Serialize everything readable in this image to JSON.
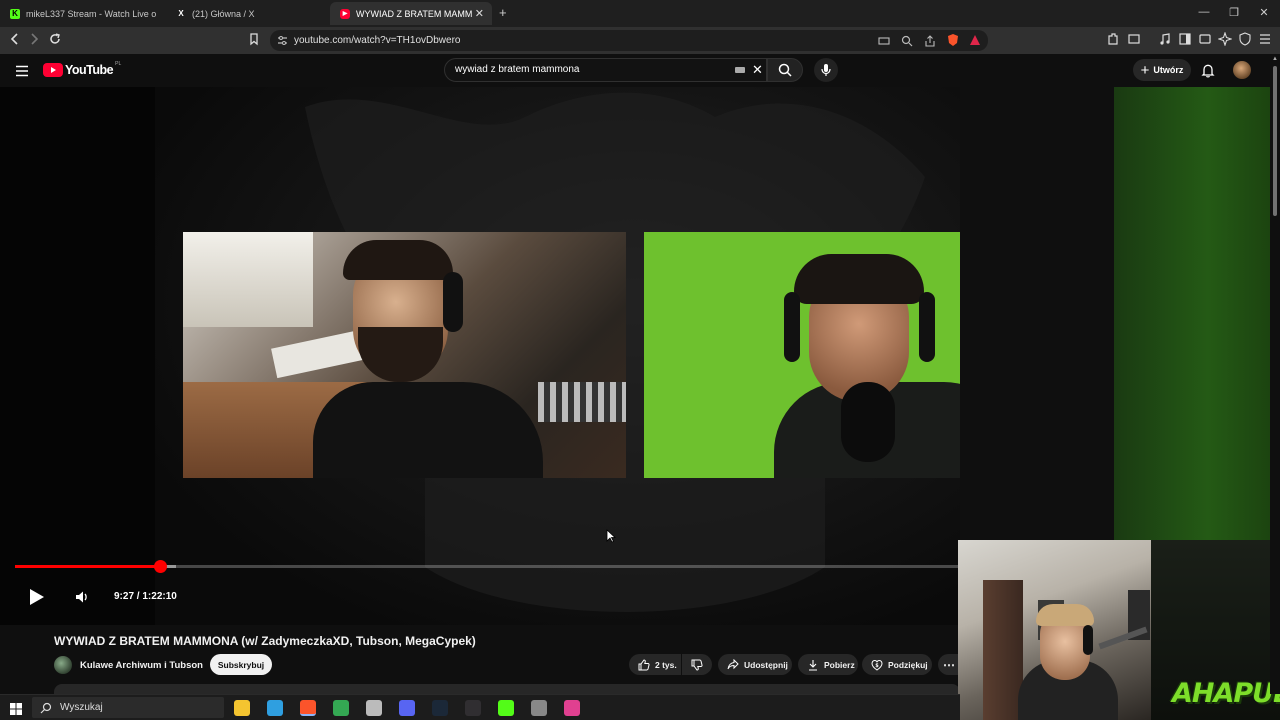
{
  "browser": {
    "tabs": [
      {
        "title": "mikeL337 Stream - Watch Live o",
        "favicon_color": "#53fc18",
        "favicon_glyph": "K",
        "active": false
      },
      {
        "title": "(21) Główna / X",
        "favicon_color": "#000000",
        "favicon_glyph": "X",
        "active": false
      },
      {
        "title": "WYWIAD Z BRATEM MAMMON/",
        "favicon_color": "#ff0033",
        "favicon_glyph": "▶",
        "active": true
      }
    ],
    "url": "youtube.com/watch?v=TH1ovDbwero"
  },
  "youtube": {
    "logo_text": "YouTube",
    "region": "PL",
    "search_value": "wywiad z bratem mammona",
    "create_label": "Utwórz"
  },
  "player": {
    "progress_fraction": 0.1537,
    "buffered_fraction": 0.17,
    "time_current": "9:27",
    "time_separator": "/",
    "time_total": "1:22:10"
  },
  "video": {
    "title": "WYWIAD Z BRATEM MAMMONA (w/ ZadymeczkaXD, Tubson, MegaCypek)",
    "channel": "Kulawe Archiwum i Tubson",
    "subscribe_label": "Subskrybuj",
    "likes": "2 tys.",
    "share_label": "Udostępnij",
    "download_label": "Pobierz",
    "thanks_label": "Podziękuj"
  },
  "overlay": {
    "brand_text": "AHAPULCO"
  },
  "taskbar": {
    "search_placeholder": "Wyszukaj",
    "apps": [
      {
        "name": "file-explorer-icon",
        "color": "#f4c430"
      },
      {
        "name": "edge-icon",
        "color": "#2f9fe0"
      },
      {
        "name": "brave-icon",
        "color": "#fb542b"
      },
      {
        "name": "chrome-icon",
        "color": "#34a853"
      },
      {
        "name": "app-icon",
        "color": "#bbbbbb"
      },
      {
        "name": "discord-icon",
        "color": "#5865f2"
      },
      {
        "name": "steam-icon",
        "color": "#1b2838"
      },
      {
        "name": "obs-icon",
        "color": "#302e31"
      },
      {
        "name": "kick-icon",
        "color": "#53fc18"
      },
      {
        "name": "app-icon-2",
        "color": "#888888"
      },
      {
        "name": "app-icon-3",
        "color": "#e04090"
      }
    ]
  }
}
